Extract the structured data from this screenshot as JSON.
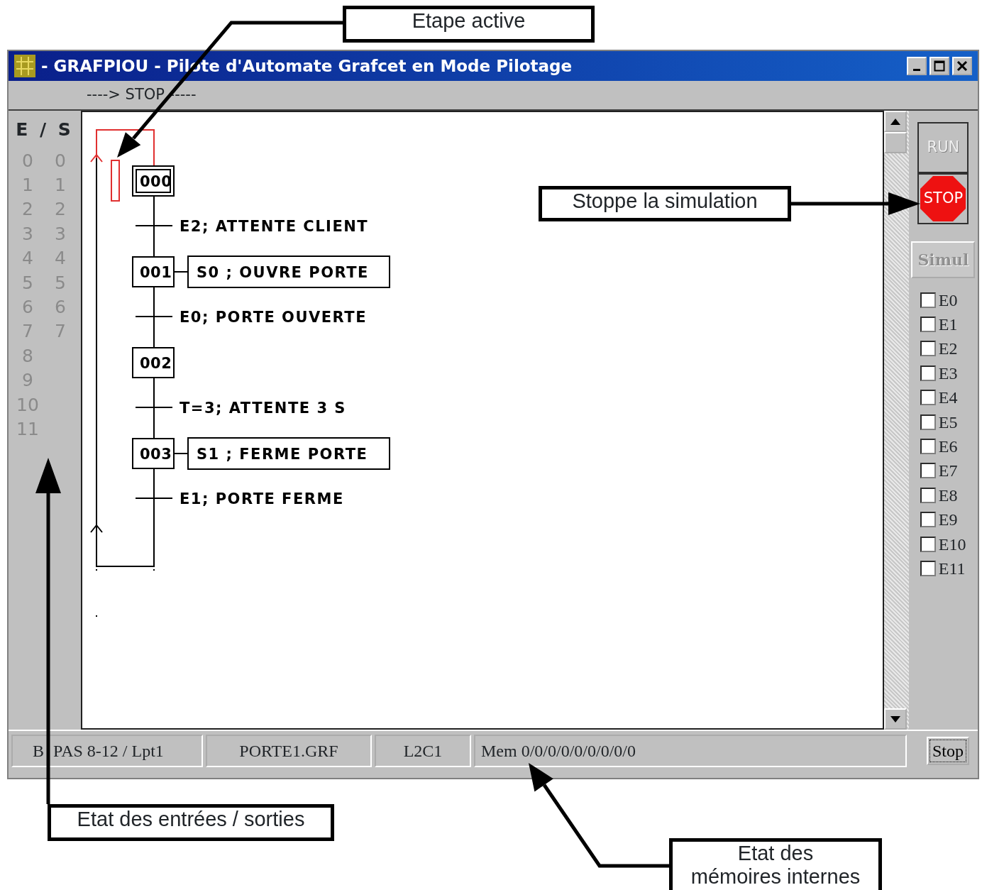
{
  "window": {
    "title": "- GRAFPIOU - Pilote d'Automate Grafcet en Mode Pilotage"
  },
  "menu": {
    "label": "----> STOP -----"
  },
  "io_panel": {
    "header": "E / S",
    "inputs": [
      {
        "label": "0",
        "on": false
      },
      {
        "label": "1",
        "on": false
      },
      {
        "label": "2",
        "on": false
      },
      {
        "label": "3",
        "on": false
      },
      {
        "label": "4",
        "on": false
      },
      {
        "label": "5",
        "on": false
      },
      {
        "label": "6",
        "on": false
      },
      {
        "label": "7",
        "on": false
      },
      {
        "label": "8",
        "on": false
      },
      {
        "label": "9",
        "on": false
      },
      {
        "label": "10",
        "on": false
      },
      {
        "label": "11",
        "on": false
      }
    ],
    "outputs": [
      {
        "label": "0",
        "on": false
      },
      {
        "label": "1",
        "on": false
      },
      {
        "label": "2",
        "on": false
      },
      {
        "label": "3",
        "on": false
      },
      {
        "label": "4",
        "on": false
      },
      {
        "label": "5",
        "on": false
      },
      {
        "label": "6",
        "on": false
      },
      {
        "label": "7",
        "on": false
      }
    ]
  },
  "grafcet": {
    "steps": [
      {
        "label": "000",
        "initial": true,
        "active": true
      },
      {
        "label": "001",
        "initial": false,
        "active": false,
        "action": "S0 ; OUVRE PORTE"
      },
      {
        "label": "002",
        "initial": false,
        "active": false
      },
      {
        "label": "003",
        "initial": false,
        "active": false,
        "action": "S1 ; FERME PORTE"
      }
    ],
    "transitions": [
      {
        "label": "E2; ATTENTE CLIENT"
      },
      {
        "label": "E0; PORTE OUVERTE"
      },
      {
        "label": "T=3; ATTENTE 3 S"
      },
      {
        "label": "E1; PORTE FERME"
      }
    ]
  },
  "controls": {
    "run": {
      "label": "RUN",
      "disabled": true
    },
    "stop": {
      "label": "STOP",
      "disabled": false
    },
    "simul": {
      "label": "Simul",
      "disabled": true
    },
    "inputs": [
      {
        "label": "E0",
        "checked": false
      },
      {
        "label": "E1",
        "checked": false
      },
      {
        "label": "E2",
        "checked": false
      },
      {
        "label": "E3",
        "checked": false
      },
      {
        "label": "E4",
        "checked": false
      },
      {
        "label": "E5",
        "checked": false
      },
      {
        "label": "E6",
        "checked": false
      },
      {
        "label": "E7",
        "checked": false
      },
      {
        "label": "E8",
        "checked": false
      },
      {
        "label": "E9",
        "checked": false
      },
      {
        "label": "E10",
        "checked": false
      },
      {
        "label": "E11",
        "checked": false
      }
    ]
  },
  "status_bar": {
    "panes": [
      [
        "B",
        "PAS 8-12 / Lpt1"
      ],
      "PORTE1.GRF",
      "L2C1",
      "Mem 0/0/0/0/0/0/0/0/0"
    ],
    "button": "Stop"
  },
  "annotations": [
    {
      "text": "Etape active"
    },
    {
      "text": "Stoppe la simulation"
    },
    {
      "text": "Etat des entrées / sorties"
    },
    {
      "text": "Etat des\nmémoires internes"
    }
  ]
}
